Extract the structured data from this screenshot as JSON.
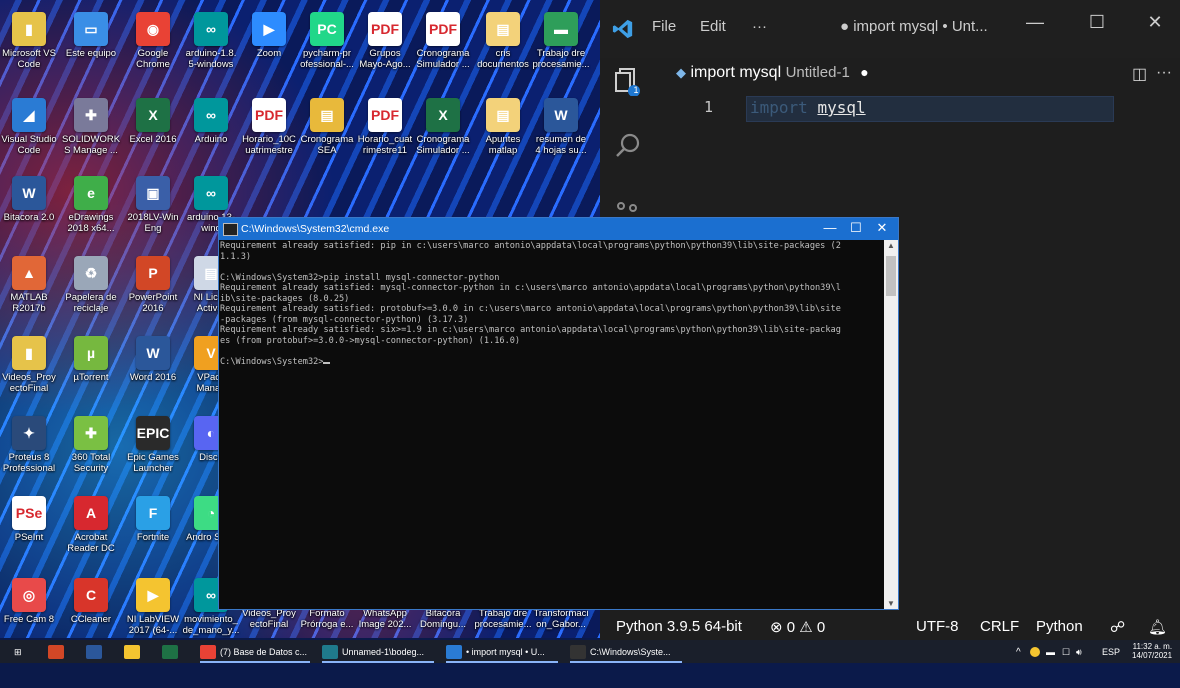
{
  "desktop": {
    "icons": [
      {
        "label": "Microsoft VS Code",
        "glyph": "▮",
        "color": "#e6c34a"
      },
      {
        "label": "Este equipo",
        "glyph": "▭",
        "color": "#3a8ee6"
      },
      {
        "label": "Google Chrome",
        "glyph": "◉",
        "color": "#e94235"
      },
      {
        "label": "arduino-1.8. 5-windows",
        "glyph": "∞",
        "color": "#00979c"
      },
      {
        "label": "Zoom",
        "glyph": "▶",
        "color": "#2d8cff"
      },
      {
        "label": "pycharm-pr ofessional-...",
        "glyph": "PC",
        "color": "#21d789"
      },
      {
        "label": "Grupos Mayo-Ago...",
        "glyph": "PDF",
        "color": "#ffffff"
      },
      {
        "label": "Cronograma Simulador ...",
        "glyph": "PDF",
        "color": "#ffffff"
      },
      {
        "label": "cris documentos",
        "glyph": "▤",
        "color": "#f3d27a"
      },
      {
        "label": "Trabajo dre procesamie...",
        "glyph": "▬",
        "color": "#2e9e5a"
      },
      {
        "label": "Visual Studio Code",
        "glyph": "◢",
        "color": "#2a7bd4"
      },
      {
        "label": "SOLIDWORK S Manage ...",
        "glyph": "✚",
        "color": "#7a7a9a"
      },
      {
        "label": "Excel 2016",
        "glyph": "X",
        "color": "#1e7145"
      },
      {
        "label": "Arduino",
        "glyph": "∞",
        "color": "#00979c"
      },
      {
        "label": "Horario_10C uatrimestre",
        "glyph": "PDF",
        "color": "#ffffff"
      },
      {
        "label": "Cronograma SEA",
        "glyph": "▤",
        "color": "#e8b93b"
      },
      {
        "label": "Horario_cuat rimestre11",
        "glyph": "PDF",
        "color": "#ffffff"
      },
      {
        "label": "Cronograma Simulador ...",
        "glyph": "X",
        "color": "#1e7145"
      },
      {
        "label": "Apuntes matlap",
        "glyph": "▤",
        "color": "#f3d27a"
      },
      {
        "label": "resumen de 4 hojas su...",
        "glyph": "W",
        "color": "#2b579a"
      },
      {
        "label": "Bitacora 2.0",
        "glyph": "W",
        "color": "#2b579a"
      },
      {
        "label": "eDrawings 2018 x64...",
        "glyph": "e",
        "color": "#3fae49"
      },
      {
        "label": "2018LV-Win Eng",
        "glyph": "▣",
        "color": "#3a5fa8"
      },
      {
        "label": "arduino 13-wind",
        "glyph": "∞",
        "color": "#00979c"
      },
      {
        "label": "MATLAB R2017b",
        "glyph": "▲",
        "color": "#e16737"
      },
      {
        "label": "Papelera de reciclaje",
        "glyph": "♻",
        "color": "#9aa7b8"
      },
      {
        "label": "PowerPoint 2016",
        "glyph": "P",
        "color": "#d24726"
      },
      {
        "label": "NI Licen Activat",
        "glyph": "▤",
        "color": "#cfd8e6"
      },
      {
        "label": "Videos_Proy ectoFinal",
        "glyph": "▮",
        "color": "#e6c34a"
      },
      {
        "label": "µTorrent",
        "glyph": "µ",
        "color": "#76b83f"
      },
      {
        "label": "Word 2016",
        "glyph": "W",
        "color": "#2b579a"
      },
      {
        "label": "VPack Manag",
        "glyph": "V",
        "color": "#f0a020"
      },
      {
        "label": "Proteus 8 Professional",
        "glyph": "✦",
        "color": "#2a4a7a"
      },
      {
        "label": "360 Total Security",
        "glyph": "✚",
        "color": "#7ac043"
      },
      {
        "label": "Epic Games Launcher",
        "glyph": "EPIC",
        "color": "#2a2a2a"
      },
      {
        "label": "Disco",
        "glyph": "◐",
        "color": "#5865f2"
      },
      {
        "label": "PSeInt",
        "glyph": "PSe",
        "color": "#ffffff"
      },
      {
        "label": "Acrobat Reader DC",
        "glyph": "A",
        "color": "#d7282f"
      },
      {
        "label": "Fortnite",
        "glyph": "F",
        "color": "#2aa0e6"
      },
      {
        "label": "Andro Studi",
        "glyph": "◔",
        "color": "#3ddc84"
      },
      {
        "label": "Free Cam 8",
        "glyph": "◎",
        "color": "#e84a4a"
      },
      {
        "label": "CCleaner",
        "glyph": "C",
        "color": "#d8352a"
      },
      {
        "label": "NI LabVIEW 2017 (64-...",
        "glyph": "▶",
        "color": "#f4c430"
      },
      {
        "label": "movimiento_ de_mano_y...",
        "glyph": "∞",
        "color": "#00979c"
      },
      {
        "label": "Videos_Proy ectoFinal",
        "glyph": "",
        "color": ""
      },
      {
        "label": "Formato Prórroga e...",
        "glyph": "",
        "color": ""
      },
      {
        "label": "WhatsApp Image 202...",
        "glyph": "",
        "color": ""
      },
      {
        "label": "Bitacora Domingu...",
        "glyph": "",
        "color": ""
      },
      {
        "label": "Trabajo dre procesamie...",
        "glyph": "",
        "color": ""
      },
      {
        "label": "Transformaci on_Gabor...",
        "glyph": "",
        "color": ""
      }
    ]
  },
  "vscode": {
    "menu": [
      "File",
      "Edit",
      "···"
    ],
    "title": "● import mysql • Unt...",
    "tab": {
      "icon": "python-icon",
      "name": "import mysql",
      "desc": "Untitled-1",
      "dirty": "●"
    },
    "badge": "1",
    "line_number": "1",
    "code_keyword": "import",
    "code_module": "mysql",
    "status": {
      "python": "Python 3.9.5 64-bit",
      "problems": "⊗ 0 ⚠ 0",
      "encoding": "UTF-8",
      "eol": "CRLF",
      "language": "Python"
    }
  },
  "cmd": {
    "title": "C:\\Windows\\System32\\cmd.exe",
    "lines": [
      "Requirement already satisfied: pip in c:\\users\\marco antonio\\appdata\\local\\programs\\python\\python39\\lib\\site-packages (2",
      "1.1.3)",
      "",
      "C:\\Windows\\System32>pip install mysql-connector-python",
      "Requirement already satisfied: mysql-connector-python in c:\\users\\marco antonio\\appdata\\local\\programs\\python\\python39\\l",
      "ib\\site-packages (8.0.25)",
      "Requirement already satisfied: protobuf>=3.0.0 in c:\\users\\marco antonio\\appdata\\local\\programs\\python\\python39\\lib\\site",
      "-packages (from mysql-connector-python) (3.17.3)",
      "Requirement already satisfied: six>=1.9 in c:\\users\\marco antonio\\appdata\\local\\programs\\python\\python39\\lib\\site-packag",
      "es (from protobuf>=3.0.0->mysql-connector-python) (1.16.0)",
      "",
      "C:\\Windows\\System32>"
    ]
  },
  "taskbar": {
    "items": [
      {
        "label": "",
        "color": "#d24726"
      },
      {
        "label": "",
        "color": "#2b579a"
      },
      {
        "label": "",
        "color": "#f4c430"
      },
      {
        "label": "",
        "color": "#1e7145"
      },
      {
        "label": "(7) Base de Datos c...",
        "color": "#e94235"
      },
      {
        "label": "Unnamed-1\\bodeg...",
        "color": "#1f7a8c"
      },
      {
        "label": "• import mysql • U...",
        "color": "#2a7bd4"
      },
      {
        "label": "C:\\Windows\\Syste...",
        "color": "#333333"
      }
    ],
    "lang": "ESP",
    "time": "11:32 a. m.",
    "date": "14/07/2021"
  }
}
